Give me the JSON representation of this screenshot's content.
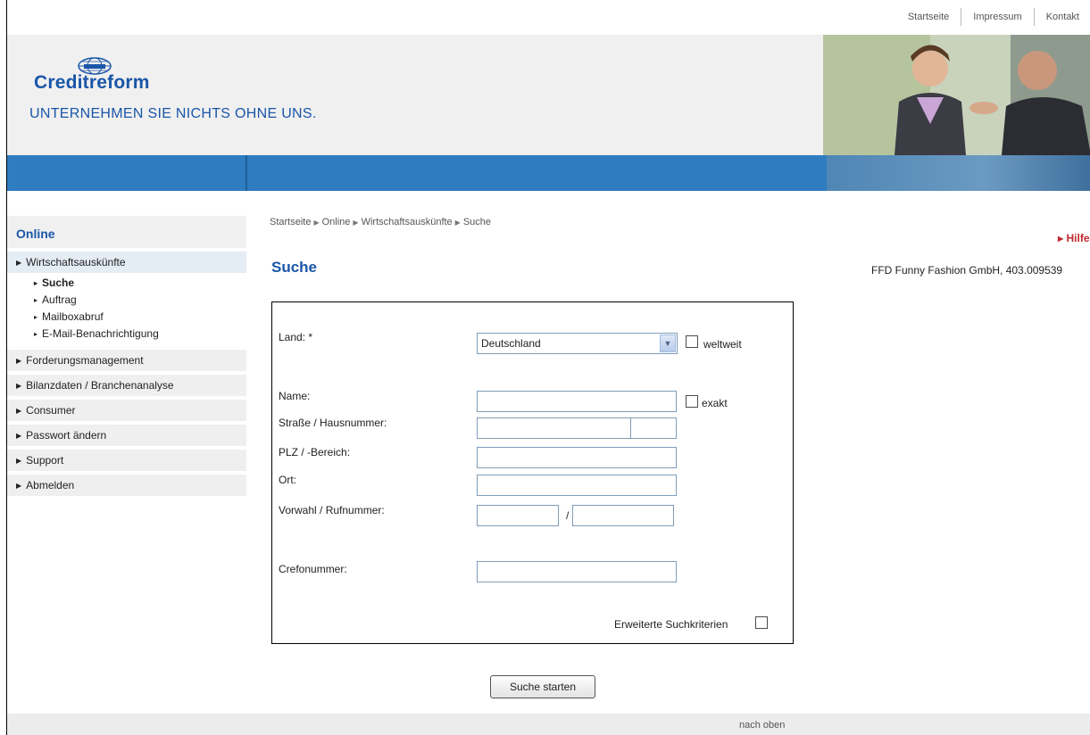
{
  "toplinks": [
    "Startseite",
    "Impressum",
    "Kontakt"
  ],
  "brand": {
    "name": "Creditreform",
    "slogan": "UNTERNEHMEN SIE NICHTS OHNE UNS.",
    "color": "#1a56a8"
  },
  "sidebar": {
    "title": "Online",
    "items": [
      {
        "label": "Wirtschaftsauskünfte"
      },
      {
        "label": "Forderungsmanagement"
      },
      {
        "label": "Bilanzdaten / Branchenanalyse"
      },
      {
        "label": "Consumer"
      },
      {
        "label": "Passwort ändern"
      },
      {
        "label": "Support"
      },
      {
        "label": "Abmelden"
      }
    ],
    "subitems": [
      "Suche",
      "Auftrag",
      "Mailboxabruf",
      "E-Mail-Benachrichtigung"
    ]
  },
  "breadcrumb": [
    "Startseite",
    "Online",
    "Wirtschaftsauskünfte",
    "Suche"
  ],
  "page": {
    "title": "Suche",
    "help": "Hilfe",
    "company": "FFD Funny Fashion GmbH, 403.009539"
  },
  "form": {
    "land_label": "Land: *",
    "land_value": "Deutschland",
    "weltweit_label": "weltweit",
    "name_label": "Name:",
    "exakt_label": "exakt",
    "strasse_label": "Straße / Hausnummer:",
    "plz_label": "PLZ / -Bereich:",
    "ort_label": "Ort:",
    "vorwahl_label": "Vorwahl / Rufnummer:",
    "slash": "/",
    "crefo_label": "Crefonummer:",
    "erweitert_label": "Erweiterte Suchkriterien",
    "submit_label": "Suche starten"
  },
  "footer": {
    "top_label": "nach oben"
  }
}
